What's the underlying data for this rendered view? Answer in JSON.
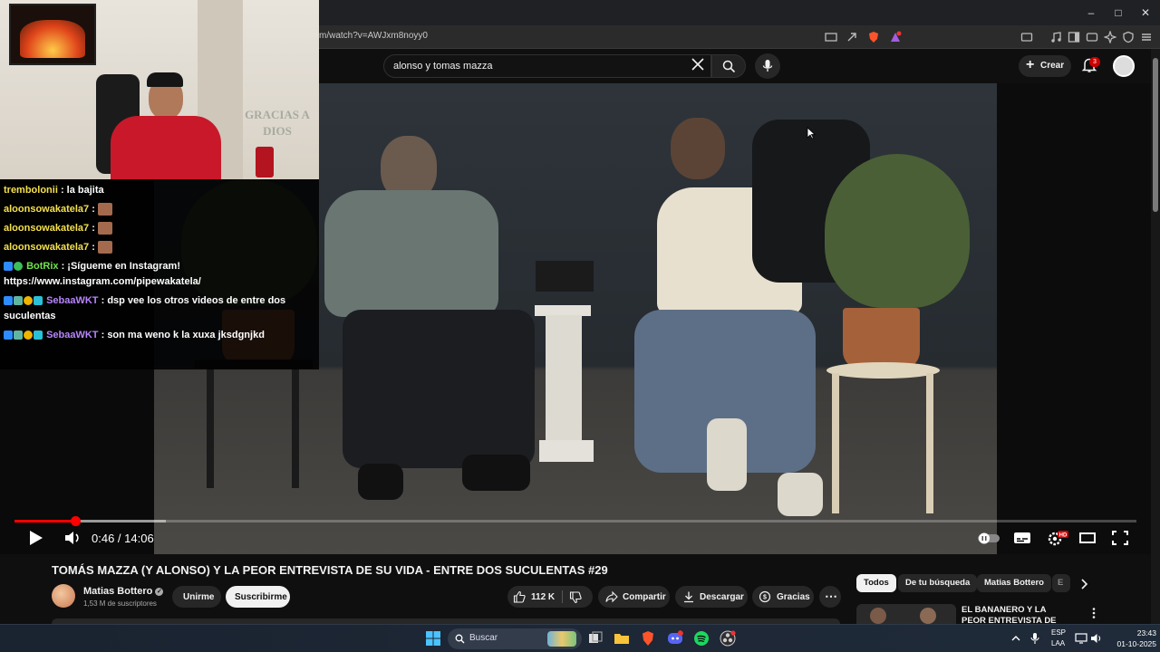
{
  "browser": {
    "url": "m/watch?v=AWJxm8noyy0"
  },
  "youtube": {
    "search_query": "alonso y tomas mazza",
    "create_label": "Crear",
    "notification_count": "3"
  },
  "player": {
    "current_time": "0:46",
    "duration": "14:06",
    "time_display": "0:46 / 14:06",
    "progress_fraction": 0.0544,
    "buffer_fraction": 0.135
  },
  "video": {
    "title": "TOMÁS MAZZA (Y ALONSO) Y LA PEOR ENTREVISTA DE SU VIDA - ENTRE DOS SUCULENTAS #29",
    "channel_name": "Matias Bottero",
    "subscribers": "1,53 M de suscriptores",
    "join_label": "Unirme",
    "subscribe_label": "Suscribirme",
    "likes": "112 K",
    "share_label": "Compartir",
    "download_label": "Descargar",
    "thanks_label": "Gracias"
  },
  "chips": [
    "Todos",
    "De tu búsqueda",
    "Matias Bottero",
    "E"
  ],
  "recommendation": {
    "title": "EL BANANERO Y LA PEOR ENTREVISTA DE SU VIDA -"
  },
  "stream_chat": [
    {
      "user": "trembolonii",
      "text": "la bajita",
      "emote": false
    },
    {
      "user": "aloonsowakatela7",
      "text": "",
      "emote": true
    },
    {
      "user": "aloonsowakatela7",
      "text": "",
      "emote": true
    },
    {
      "user": "aloonsowakatela7",
      "text": "",
      "emote": true
    },
    {
      "user": "BotRix",
      "text": "¡Sígueme en Instagram! https://www.instagram.com/pipewakatela/",
      "emote": false
    },
    {
      "user": "SebaaWKT",
      "text": "dsp vee los otros videos de entre dos suculentas",
      "emote": false
    },
    {
      "user": "SebaaWKT",
      "text": "son ma weno k la xuxa jksdgnjkd",
      "emote": false
    }
  ],
  "webcam": {
    "wall_text": "GRACIAS A DIOS"
  },
  "taskbar": {
    "search_label": "Buscar",
    "lang_line1": "ESP",
    "lang_line2": "LAA",
    "time": "23:43",
    "date": "01-10-2025"
  },
  "colors": {
    "accent_red": "#ff0000",
    "yt_bg": "#0f0f0f",
    "chip_bg": "#272727"
  }
}
